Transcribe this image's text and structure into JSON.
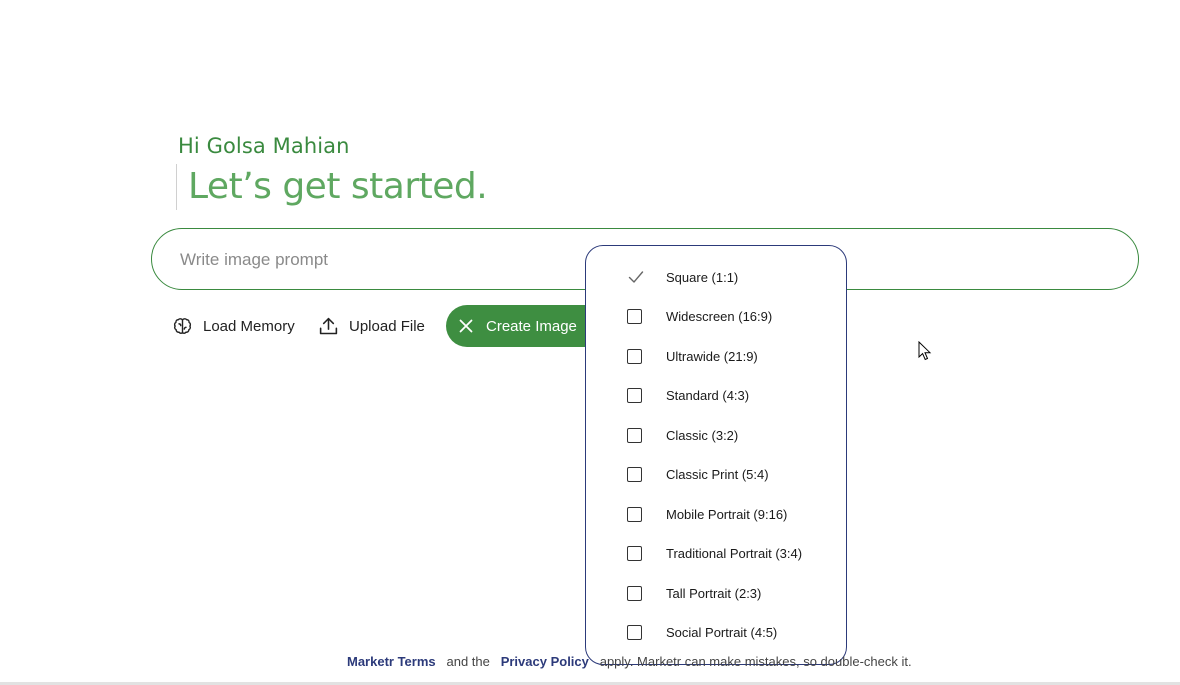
{
  "greeting": {
    "text": "Hi Golsa Mahian",
    "headline": "Let’s get started."
  },
  "prompt": {
    "placeholder": "Write image prompt",
    "value": ""
  },
  "toolbar": {
    "load_memory_label": "Load Memory",
    "upload_file_label": "Upload File",
    "create_image_label": "Create Image"
  },
  "aspect_dropdown": {
    "selected": "Square (1:1)",
    "options": [
      {
        "label": "Square (1:1)",
        "checked": true
      },
      {
        "label": "Widescreen (16:9)",
        "checked": false
      },
      {
        "label": "Ultrawide (21:9)",
        "checked": false
      },
      {
        "label": "Standard (4:3)",
        "checked": false
      },
      {
        "label": "Classic (3:2)",
        "checked": false
      },
      {
        "label": "Classic Print (5:4)",
        "checked": false
      },
      {
        "label": "Mobile Portrait (9:16)",
        "checked": false
      },
      {
        "label": "Traditional Portrait (3:4)",
        "checked": false
      },
      {
        "label": "Tall Portrait (2:3)",
        "checked": false
      },
      {
        "label": "Social Portrait (4:5)",
        "checked": false
      }
    ]
  },
  "footer": {
    "terms_link": "Marketr Terms",
    "and_the": "and the",
    "privacy_link": "Privacy Policy",
    "rest": "apply. Marketr can make mistakes, so double-check it."
  },
  "colors": {
    "brand_green": "#3e8e41",
    "headline_green": "#5fa861",
    "link_navy": "#2c3a7a"
  },
  "icons": {
    "load_memory": "brain-icon",
    "upload_file": "upload-icon",
    "create_image": "close-icon",
    "selected_option": "check-icon"
  }
}
